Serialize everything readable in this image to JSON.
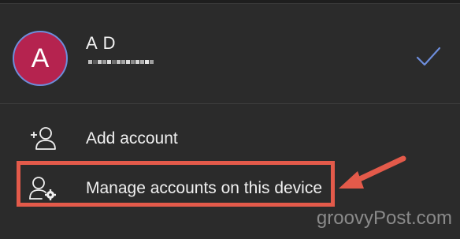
{
  "account": {
    "avatar_letter": "A",
    "name": "A D",
    "avatar_color": "#b5234f",
    "avatar_ring_color": "#6d8ddb",
    "selected_icon": "checkmark-icon"
  },
  "menu": {
    "items": [
      {
        "label": "Add account",
        "icon": "add-person-icon"
      },
      {
        "label": "Manage accounts on this device",
        "icon": "person-settings-icon"
      }
    ]
  },
  "annotation": {
    "highlight_color": "#e35a4a"
  },
  "watermark": "groovyPost.com"
}
